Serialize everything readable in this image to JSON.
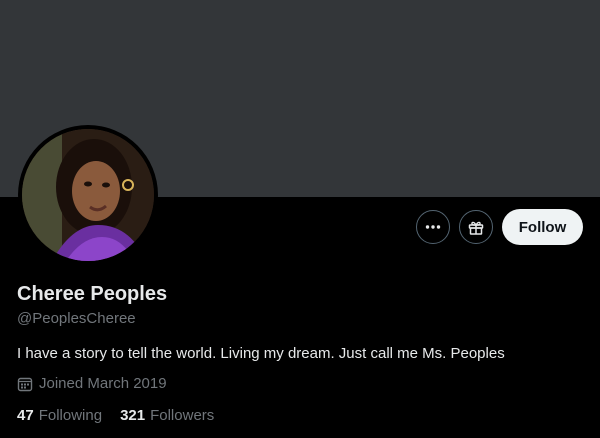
{
  "profile": {
    "name": "Cheree Peoples",
    "handle": "@PeoplesCheree",
    "bio": "I have a story to tell the world. Living my dream. Just call me Ms. Peoples",
    "joined": "Joined March 2019"
  },
  "actions": {
    "more_icon": "more-icon",
    "gift_icon": "gift-icon",
    "follow_label": "Follow"
  },
  "stats": {
    "following_count": "47",
    "following_label": "Following",
    "followers_count": "321",
    "followers_label": "Followers"
  },
  "colors": {
    "banner": "#333639",
    "background": "#000000",
    "primary_text": "#e7e9ea",
    "secondary_text": "#71767b",
    "follow_button_bg": "#eff3f4"
  }
}
